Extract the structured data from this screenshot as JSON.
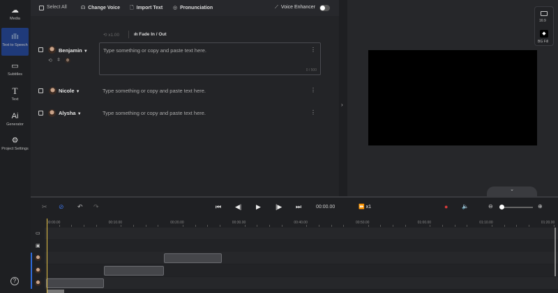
{
  "sidebar": {
    "items": [
      {
        "icon": "cloud-upload-icon",
        "label": "Media"
      },
      {
        "icon": "waveform-icon",
        "label": "Text to Speech",
        "active": true
      },
      {
        "icon": "subtitles-icon",
        "label": "Subtitles"
      },
      {
        "icon": "text-icon",
        "label": "Text"
      },
      {
        "icon": "ai-icon",
        "label": "Generator",
        "glyph": "Ai"
      },
      {
        "icon": "gear-icon",
        "label": "Project Settings"
      }
    ],
    "help": "?"
  },
  "toolbar": {
    "select_all": "Select All",
    "change_voice": "Change Voice",
    "import_text": "Import Text",
    "pronunciation": "Pronunciation",
    "voice_enhancer": "Voice Enhancer",
    "voice_enhancer_on": false
  },
  "row_tools": {
    "speed": "x1.00",
    "fade": "Fade In / Out"
  },
  "rows": [
    {
      "name": "Benjamin",
      "placeholder": "Type something or copy and paste text here.",
      "count": "0 / 500"
    },
    {
      "name": "Nicole",
      "placeholder": "Type something or copy and paste text here."
    },
    {
      "name": "Alysha",
      "placeholder": "Type something or copy and paste text here."
    }
  ],
  "preview": {
    "ratio": "16:9",
    "bg_fill": "BG Fill"
  },
  "timeline": {
    "time": "00:00.00",
    "speed": "x1",
    "zoom_level": 0.05,
    "ticks": [
      "00:00.00",
      "00:10.00",
      "00:20.00",
      "00:30.00",
      "00:40.00",
      "00:50.00",
      "01:00.00",
      "01:10.00",
      "01:20.00"
    ]
  },
  "colors": {
    "accent": "#1f3a7a",
    "playhead": "#e8c447",
    "mic": "#d93b3b"
  }
}
